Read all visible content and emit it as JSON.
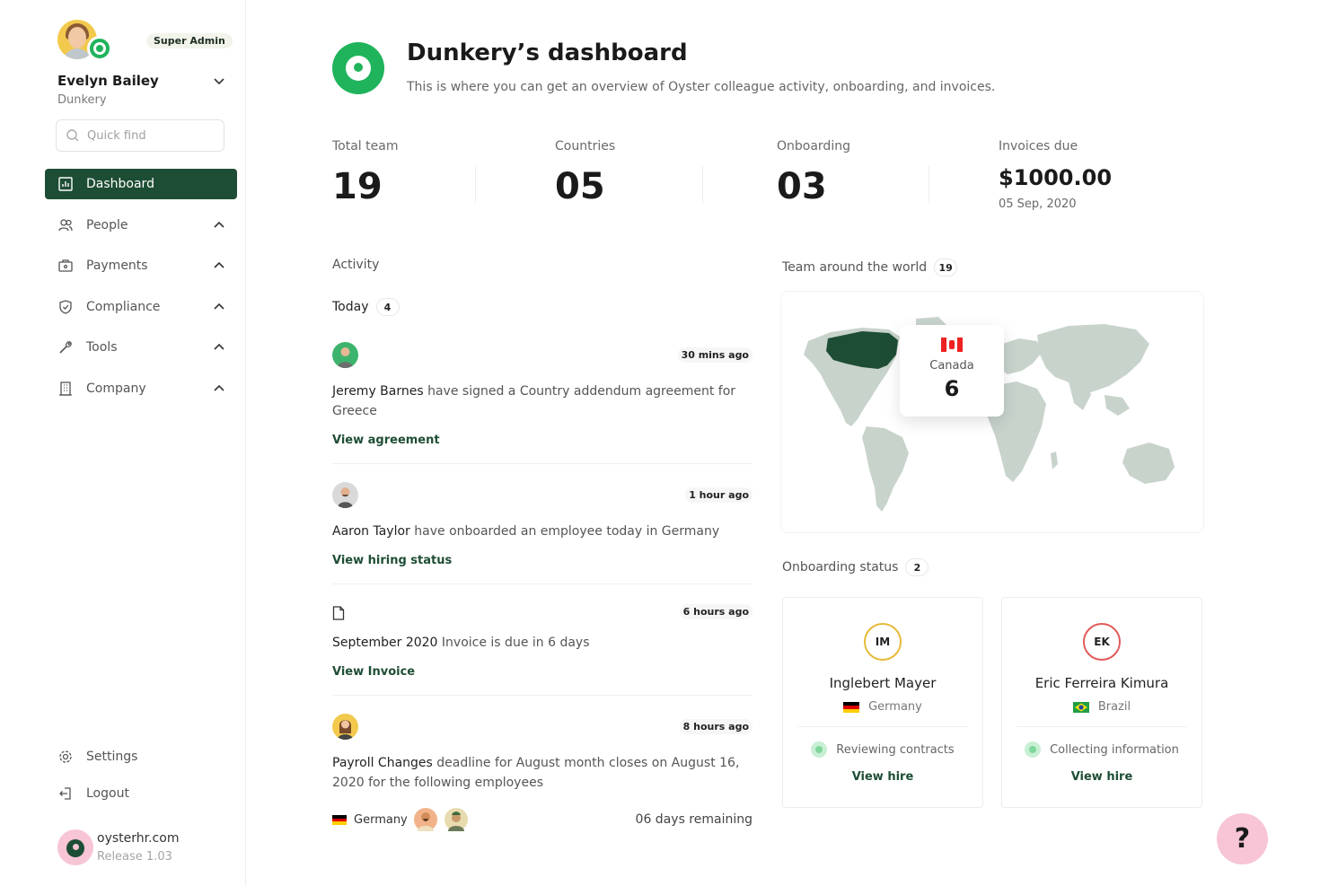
{
  "user": {
    "name": "Evelyn Bailey",
    "org": "Dunkery",
    "role": "Super Admin"
  },
  "search": {
    "placeholder": "Quick find"
  },
  "nav": [
    {
      "label": "Dashboard",
      "icon": "chart-icon",
      "active": true
    },
    {
      "label": "People",
      "icon": "people-icon"
    },
    {
      "label": "Payments",
      "icon": "wallet-icon"
    },
    {
      "label": "Compliance",
      "icon": "shield-icon"
    },
    {
      "label": "Tools",
      "icon": "tools-icon"
    },
    {
      "label": "Company",
      "icon": "building-icon"
    }
  ],
  "bottom_nav": [
    {
      "label": "Settings",
      "icon": "gear-icon"
    },
    {
      "label": "Logout",
      "icon": "logout-icon"
    }
  ],
  "brand": {
    "name": "oysterhr.com",
    "release": "Release 1.03"
  },
  "header": {
    "title": "Dunkery’s dashboard",
    "subtitle": "This is where you can get an overview of Oyster colleague activity, onboarding, and invoices."
  },
  "stats": [
    {
      "label": "Total team",
      "value": "19"
    },
    {
      "label": "Countries",
      "value": "05"
    },
    {
      "label": "Onboarding",
      "value": "03"
    },
    {
      "label": "Invoices due",
      "value": "$1000.00",
      "date": "05 Sep, 2020"
    }
  ],
  "activity": {
    "label": "Activity",
    "today_label": "Today",
    "today_count": "4",
    "items": [
      {
        "time": "30 mins ago",
        "actor": "Jeremy Barnes",
        "text": " have signed a Country addendum agreement for Greece",
        "link": "View agreement"
      },
      {
        "time": "1 hour ago",
        "actor": "Aaron Taylor",
        "text": " have onboarded an employee today in Germany",
        "link": "View hiring status"
      },
      {
        "time": "6 hours ago",
        "actor": "September 2020",
        "text": " Invoice is due in 6 days",
        "link": "View Invoice"
      },
      {
        "time": "8 hours ago",
        "actor": "Payroll Changes",
        "text": " deadline for August month closes on August 16, 2020 for the following employees",
        "country": "Germany",
        "remaining": "06 days remaining"
      }
    ]
  },
  "team_map": {
    "label": "Team around the world",
    "count": "19",
    "tooltip": {
      "country": "Canada",
      "count": "6"
    }
  },
  "onboarding": {
    "label": "Onboarding status",
    "count": "2",
    "cards": [
      {
        "initials": "IM",
        "name": "Inglebert Mayer",
        "country": "Germany",
        "status": "Reviewing contracts",
        "link": "View hire",
        "ring": "#e6b93a"
      },
      {
        "initials": "EK",
        "name": "Eric Ferreira Kimura",
        "country": "Brazil",
        "status": "Collecting information",
        "link": "View hire",
        "ring": "#e25a5a"
      }
    ]
  },
  "help": {
    "label": "?"
  },
  "colors": {
    "primary": "#1e4d35",
    "accent": "#1fb35b",
    "pink": "#f7c5d5"
  }
}
